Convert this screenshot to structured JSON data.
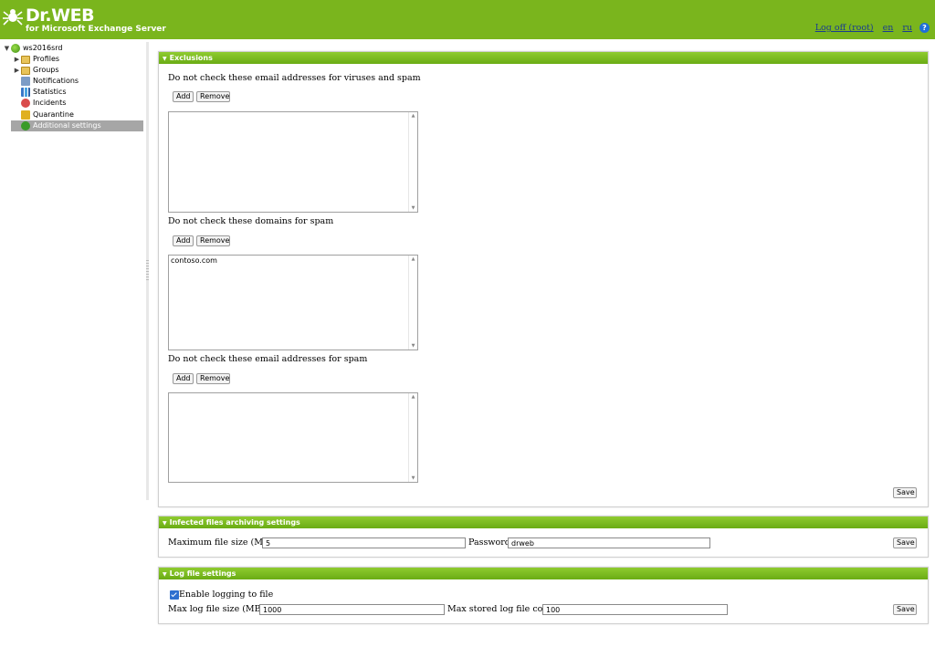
{
  "header": {
    "logo_text": "Dr.WEB",
    "logo_sub": "for Microsoft Exchange Server",
    "logoff_label": "Log off (root)",
    "lang_en": "en",
    "lang_ru": "ru",
    "help_icon": "?"
  },
  "colors": {
    "brand": "#7ab51d",
    "header_gradient_top": "#8fcb30",
    "selected": "#a6a6a6"
  },
  "tree": {
    "root": "ws2016srd",
    "items": [
      {
        "label": "Profiles",
        "icon": "folder-icon"
      },
      {
        "label": "Groups",
        "icon": "folder-icon"
      },
      {
        "label": "Notifications",
        "icon": "notifications-icon"
      },
      {
        "label": "Statistics",
        "icon": "statistics-icon"
      },
      {
        "label": "Incidents",
        "icon": "incidents-icon"
      },
      {
        "label": "Quarantine",
        "icon": "quarantine-icon"
      },
      {
        "label": "Additional settings",
        "icon": "settings-icon",
        "selected": true
      }
    ]
  },
  "exclusions": {
    "title": "Exclusions",
    "section1_label": "Do not check these email addresses for viruses and spam",
    "section2_label": "Do not check these domains for spam",
    "section2_entries": [
      "contoso.com"
    ],
    "section3_label": "Do not check these email addresses for spam",
    "add_label": "Add",
    "remove_label": "Remove",
    "save_label": "Save"
  },
  "archiving": {
    "title": "Infected files archiving settings",
    "max_size_label": "Maximum file size (MB):",
    "max_size_value": "5",
    "password_label": "Password:",
    "password_value": "drweb",
    "save_label": "Save"
  },
  "logfile": {
    "title": "Log file settings",
    "enable_label": "Enable logging to file",
    "enabled": true,
    "max_size_label": "Max log file size (MB):",
    "max_size_value": "1000",
    "max_count_label": "Max stored log file count:",
    "max_count_value": "100",
    "save_label": "Save"
  }
}
